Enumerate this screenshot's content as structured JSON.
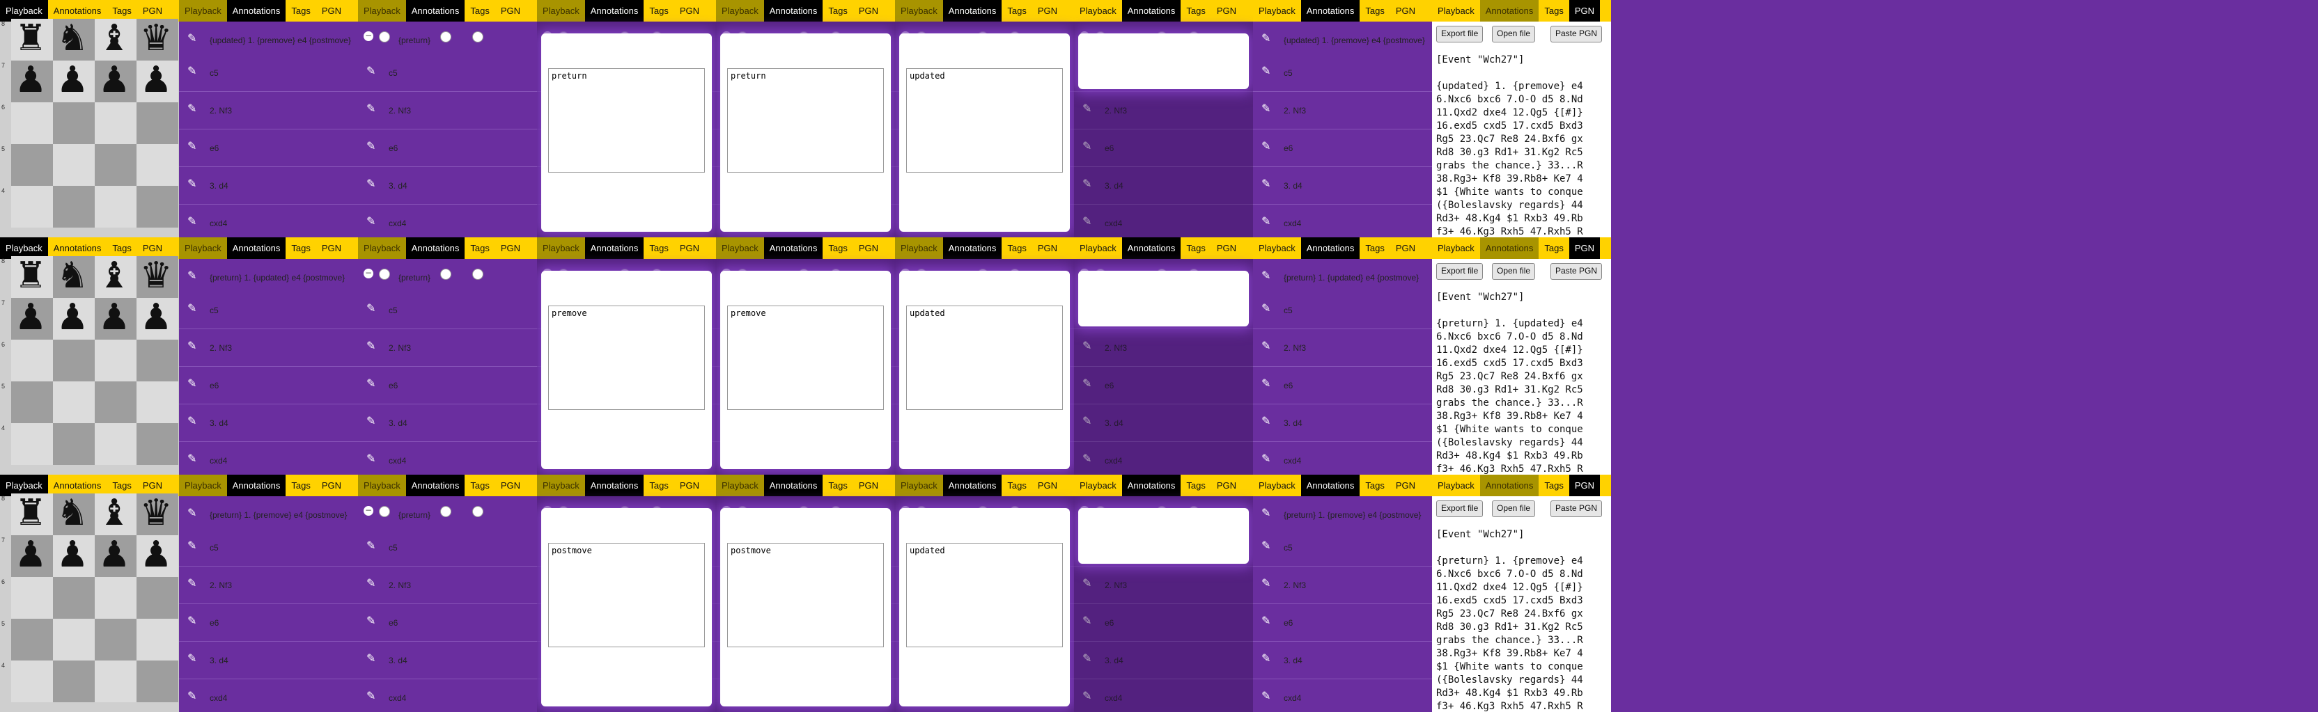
{
  "tabs": [
    "Playback",
    "Annotations",
    "Tags",
    "PGN"
  ],
  "colors": {
    "tab_bar": "#ffd200",
    "annotation_panel": "#6a2e9f",
    "modal_glow": "#8c46d2"
  },
  "icons": {
    "edit": "edit-icon",
    "remove": "minus-icon"
  },
  "moves": {
    "white1": "1. {premove} e4 {postmove}",
    "m1": "c5",
    "m2": "2. Nf3",
    "m3": "e6",
    "m4": "3. d4",
    "m5": "cxd4"
  },
  "rows": [
    {
      "comment": "{preturn}",
      "pgn_first_comment": "{updated}",
      "modal_a": "preturn",
      "modal_b": "preturn",
      "modal_c": "updated"
    },
    {
      "comment": "{preturn}",
      "pgn_first_comment": "{preturn}",
      "modal_a": "premove",
      "modal_b": "premove",
      "modal_c": "updated"
    },
    {
      "comment": "{preturn}",
      "pgn_first_comment": "{preturn}",
      "modal_a": "postmove",
      "modal_b": "postmove",
      "modal_c": "updated"
    }
  ],
  "header_line_updated": "{updated} 1. {premove} e4 {postmove}",
  "header_line_row2": "{preturn} 1. {updated} e4 {postmove}",
  "header_line_row3": "{preturn} 1. {premove} e4 {postmove}",
  "pgn_panel": {
    "buttons": [
      "Export file",
      "Open file",
      "Paste PGN"
    ],
    "event": "[Event \"Wch27\"]",
    "lines_rest": [
      "6.Nxc6 bxc6 7.O-O d5 8.Nd",
      "11.Qxd2 dxe4 12.Qg5 {[#]}",
      "16.exd5 cxd5 17.cxd5 Bxd3",
      "Rg5 23.Qc7 Re8 24.Bxf6 gx",
      "Rd8 30.g3 Rd1+ 31.Kg2 Rc5",
      "grabs the chance.} 33...R",
      "38.Rg3+ Kf8 39.Rb8+ Ke7 4",
      "$1 {White wants to conque",
      "({Boleslavsky regards} 44",
      "Rd3+ 48.Kg4 $1 Rxb3 49.Rb",
      "f3+ 46.Kg3 Rxh5 47.Rxh5 R"
    ],
    "first_lines": [
      "{updated} 1. {premove} e4",
      "{preturn} 1. {updated} e4",
      "{preturn} 1. {premove} e4"
    ]
  },
  "ranks": [
    "8",
    "7",
    "6",
    "5",
    "4"
  ],
  "pieces_rank8": [
    "♜",
    "♞",
    "♝",
    "♛"
  ],
  "pieces_rank7": [
    "♟",
    "♟",
    "♟",
    "♟"
  ]
}
